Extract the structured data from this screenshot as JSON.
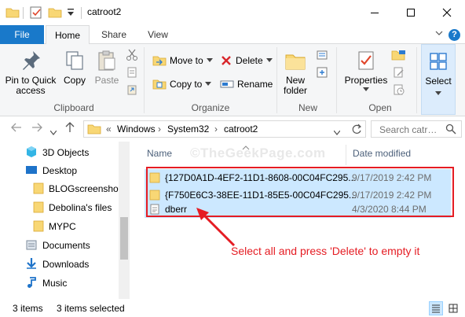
{
  "window": {
    "title": "catroot2",
    "minimize_label": "–",
    "maximize_label": "☐",
    "close_label": "✕"
  },
  "ribbon_tabs": {
    "file": "File",
    "home": "Home",
    "share": "Share",
    "view": "View"
  },
  "ribbon": {
    "clipboard": {
      "pin_label": "Pin to Quick access",
      "copy_label": "Copy",
      "paste_label": "Paste",
      "group_label": "Clipboard"
    },
    "organize": {
      "move_to_label": "Move to",
      "copy_to_label": "Copy to",
      "delete_label": "Delete",
      "rename_label": "Rename",
      "group_label": "Organize"
    },
    "new": {
      "new_folder_label": "New folder",
      "group_label": "New"
    },
    "open": {
      "properties_label": "Properties",
      "group_label": "Open"
    },
    "select": {
      "select_label": "Select"
    }
  },
  "address": {
    "overflow": "«",
    "crumbs": [
      "Windows",
      "System32",
      "catroot2"
    ],
    "search_placeholder": "Search catr…"
  },
  "nav_pane": {
    "items": [
      {
        "label": "3D Objects",
        "icon": "3d-objects-icon"
      },
      {
        "label": "Desktop",
        "icon": "desktop-icon"
      },
      {
        "label": "BLOGscreenshot",
        "icon": "folder-icon"
      },
      {
        "label": "Debolina's files",
        "icon": "folder-icon"
      },
      {
        "label": "MYPC",
        "icon": "folder-icon"
      },
      {
        "label": "Documents",
        "icon": "documents-icon"
      },
      {
        "label": "Downloads",
        "icon": "downloads-icon"
      },
      {
        "label": "Music",
        "icon": "music-icon"
      }
    ]
  },
  "file_list": {
    "columns": {
      "name": "Name",
      "date_modified": "Date modified"
    },
    "rows": [
      {
        "name": "{127D0A1D-4EF2-11D1-8608-00C04FC295...",
        "date": "9/17/2019 2:42 PM",
        "icon": "folder-icon",
        "selected": true
      },
      {
        "name": "{F750E6C3-38EE-11D1-85E5-00C04FC295...",
        "date": "9/17/2019 2:42 PM",
        "icon": "folder-icon",
        "selected": true
      },
      {
        "name": "dberr",
        "date": "4/3/2020 8:44 PM",
        "icon": "text-file-icon",
        "selected": true
      }
    ]
  },
  "watermark": "©TheGeekPage.com",
  "annotation": {
    "text": "Select all and press 'Delete' to empty it",
    "color": "#e51c23"
  },
  "status_bar": {
    "item_count": "3 items",
    "selected_count": "3 items selected"
  },
  "colors": {
    "accent": "#1979ca",
    "selection": "#cce8ff",
    "annotation_red": "#e51c23",
    "folder_yellow": "#f8d775"
  }
}
